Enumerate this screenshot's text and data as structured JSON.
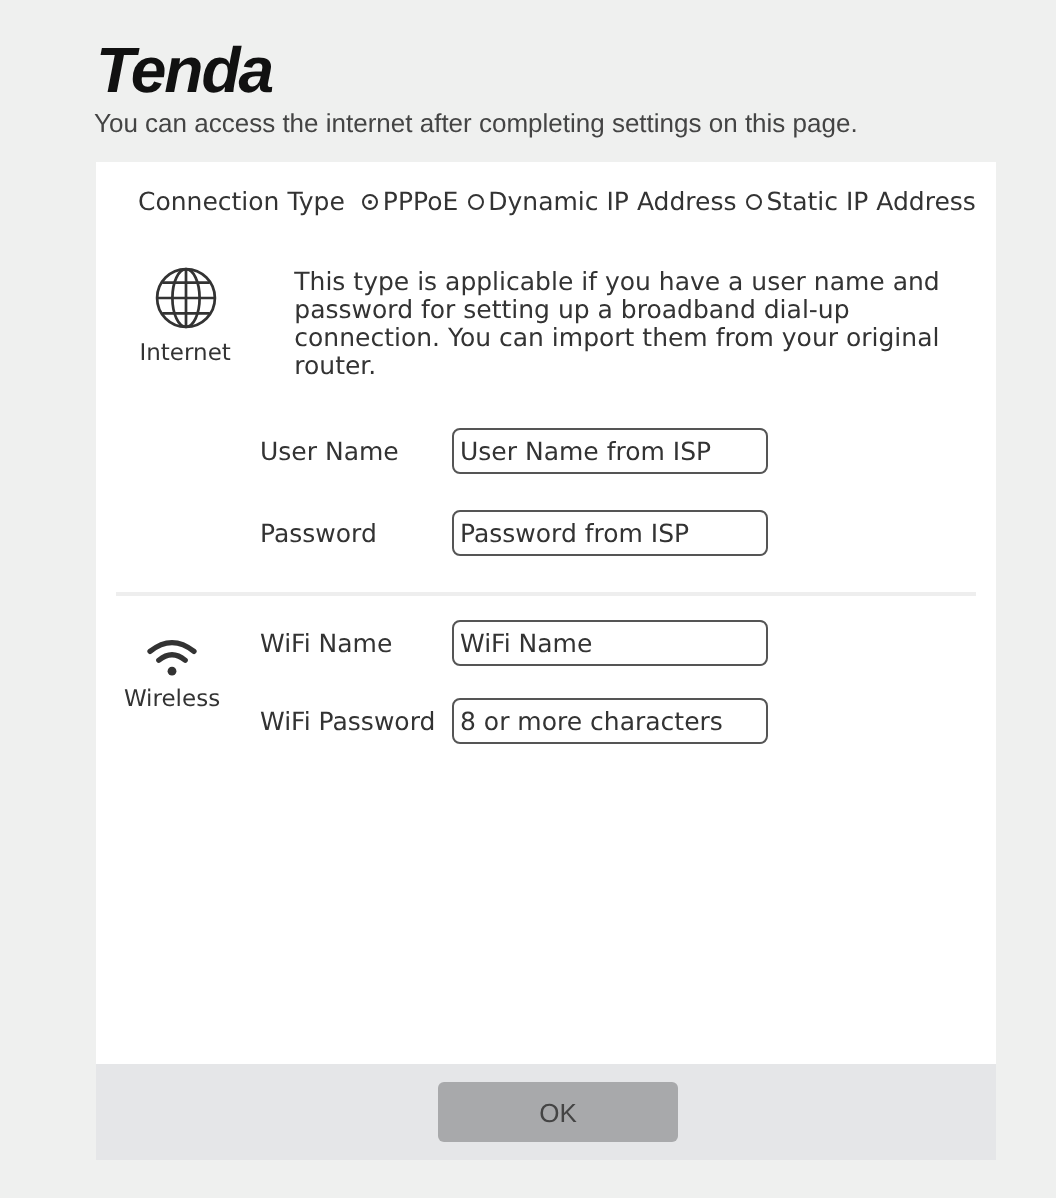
{
  "logo": "Tenda",
  "subtitle": "You can access the internet after completing settings on this page.",
  "connection_type": {
    "label": "Connection Type",
    "options": [
      {
        "label": "PPPoE",
        "selected": true
      },
      {
        "label": "Dynamic IP Address",
        "selected": false
      },
      {
        "label": "Static IP Address",
        "selected": false
      }
    ]
  },
  "internet": {
    "icon_label": "Internet",
    "description": "This type is applicable if you have a user name and password for setting up a broadband dial-up connection. You can import them from your original router.",
    "fields": [
      {
        "label": "User Name",
        "placeholder": "User Name from ISP"
      },
      {
        "label": "Password",
        "placeholder": "Password from ISP"
      }
    ]
  },
  "wireless": {
    "icon_label": "Wireless",
    "fields": [
      {
        "label": "WiFi Name",
        "placeholder": "WiFi Name"
      },
      {
        "label": "WiFi Password",
        "placeholder": "8 or more characters"
      }
    ]
  },
  "buttons": [
    "OK"
  ]
}
